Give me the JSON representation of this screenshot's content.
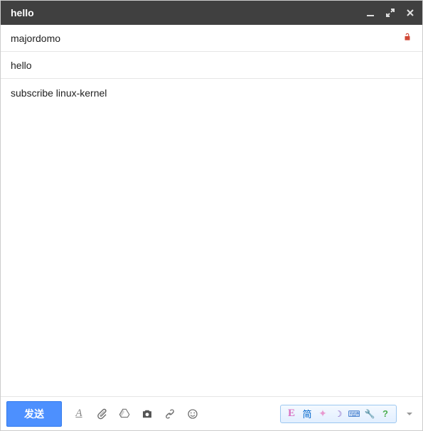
{
  "titlebar": {
    "title": "hello"
  },
  "fields": {
    "to": "majordomo",
    "subject": "hello"
  },
  "body": "subscribe linux-kernel",
  "toolbar": {
    "send_label": "发送"
  },
  "ime": {
    "e": "E",
    "jian": "简",
    "help": "?"
  }
}
